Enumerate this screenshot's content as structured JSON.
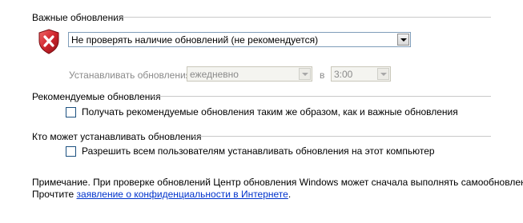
{
  "important": {
    "title": "Важные обновления",
    "mode_selected": "Не проверять наличие обновлений (не рекомендуется)",
    "install_label": "Устанавливать обновления:",
    "frequency_value": "ежедневно",
    "at_label": "в",
    "time_value": "3:00"
  },
  "recommended": {
    "title": "Рекомендуемые обновления",
    "checkbox_label": "Получать рекомендуемые обновления таким же образом, как и важные обновления",
    "checked": false
  },
  "who": {
    "title": "Кто может устанавливать обновления",
    "checkbox_label": "Разрешить всем пользователям устанавливать обновления на этот компьютер",
    "checked": false
  },
  "note": {
    "line1": "Примечание. При проверке обновлений Центр обновления Windows может сначала выполнять самообновление.",
    "line2_prefix": "Прочтите ",
    "privacy_link": "заявление о конфиденциальности в Интернете",
    "line2_suffix": "."
  },
  "icons": {
    "shield": "windows-security-shield-error-icon",
    "dropdown": "chevron-down-icon"
  },
  "colors": {
    "shield_red": "#c8232b",
    "link": "#0033cc"
  }
}
